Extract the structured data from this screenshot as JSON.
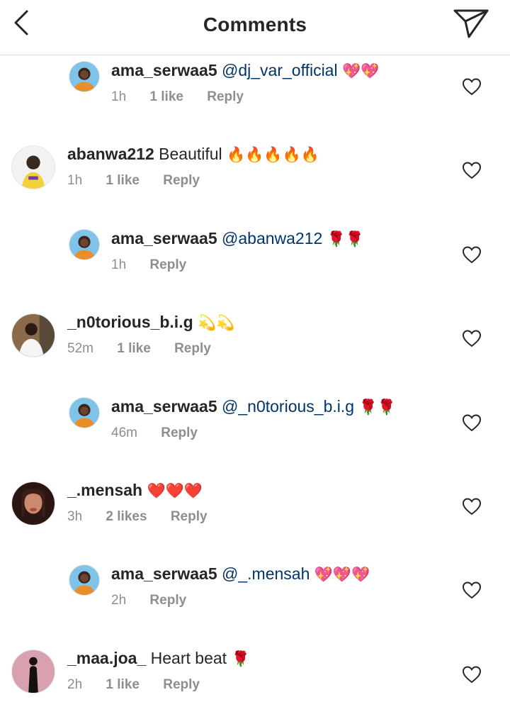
{
  "header": {
    "title": "Comments"
  },
  "comments": [
    {
      "user": "ama_serwaa5",
      "mention": "@dj_var_official",
      "text": "",
      "emoji": "💖💖",
      "time": "1h",
      "likes": "1 like",
      "reply": "Reply"
    },
    {
      "user": "abanwa212",
      "mention": "",
      "text": "Beautiful",
      "emoji": "🔥🔥🔥🔥🔥",
      "time": "1h",
      "likes": "1 like",
      "reply": "Reply"
    },
    {
      "user": "ama_serwaa5",
      "mention": "@abanwa212",
      "text": "",
      "emoji": "🌹🌹",
      "time": "1h",
      "likes": "",
      "reply": "Reply"
    },
    {
      "user": "_n0torious_b.i.g",
      "mention": "",
      "text": "",
      "emoji": "💫💫",
      "time": "52m",
      "likes": "1 like",
      "reply": "Reply"
    },
    {
      "user": "ama_serwaa5",
      "mention": "@_n0torious_b.i.g",
      "text": "",
      "emoji": "🌹🌹",
      "time": "46m",
      "likes": "",
      "reply": "Reply"
    },
    {
      "user": "_.mensah",
      "mention": "",
      "text": "",
      "emoji": "❤️❤️❤️",
      "time": "3h",
      "likes": "2 likes",
      "reply": "Reply"
    },
    {
      "user": "ama_serwaa5",
      "mention": "@_.mensah",
      "text": "",
      "emoji": "💖💖💖",
      "time": "2h",
      "likes": "",
      "reply": "Reply"
    },
    {
      "user": "_maa.joa_",
      "mention": "",
      "text": "Heart beat",
      "emoji": "🌹",
      "time": "2h",
      "likes": "1 like",
      "reply": "Reply"
    }
  ],
  "icons": {
    "back": "chevron-left-icon",
    "send": "paper-plane-icon",
    "like": "heart-outline-icon"
  },
  "colors": {
    "text": "#262626",
    "muted": "#8e8e8e",
    "mention": "#003569",
    "divider": "#dbdbdb"
  }
}
